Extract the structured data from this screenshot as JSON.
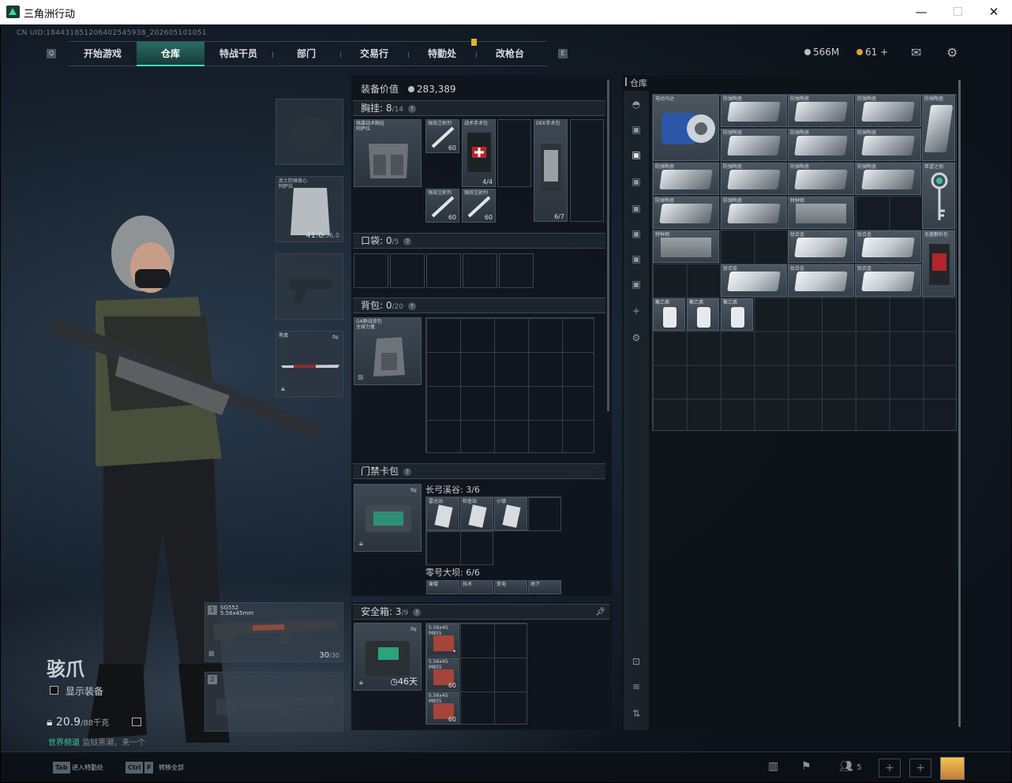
{
  "window": {
    "title": "三角洲行动",
    "controls": [
      "—",
      "☐",
      "✕"
    ]
  },
  "uid": "CN UID:18443185120640254593​8_202605101051",
  "nav": {
    "tabs": [
      "开始游戏",
      "仓库",
      "特战干员",
      "部门",
      "交易行",
      "特勤处",
      "改枪台"
    ],
    "active": "仓库"
  },
  "currency": {
    "silver": "566M",
    "gold": "61",
    "gold_add": "+"
  },
  "character": {
    "name": "骇爪",
    "show_equipment": "显示装备",
    "weight": "20.9",
    "weight_max": "/88千克",
    "ticker_prefix": "世界频道",
    "ticker_text": "监狱黑潮，来一个"
  },
  "left_slots": {
    "armor": {
      "label": "武士防弹背心\n阿萨拉",
      "value": "41.0",
      "max": "/56.0"
    },
    "melee": {
      "label": "黑鹰"
    },
    "gun1": {
      "num": "1",
      "name": "SG552",
      "caliber": "5.56x45mm",
      "ammo": "30",
      "ammo_max": "/30"
    },
    "gun2": {
      "num": "2"
    }
  },
  "equipment": {
    "value_label": "装备价值",
    "value": "283,389",
    "chest": {
      "title": "胸挂",
      "count": "8",
      "cap": "/14",
      "rig_label": "强袭战术胸挂\n阿萨拉",
      "items": [
        {
          "label": "强效注射剂",
          "n": "60"
        },
        {
          "label": "战术手术包",
          "n": "4/4"
        },
        {
          "label": "强效注射剂",
          "n": "60"
        },
        {
          "label": "强效注射剂",
          "n": "60"
        },
        {
          "label": "DEK手术包",
          "n": "6/7"
        }
      ]
    },
    "pocket": {
      "title": "口袋",
      "count": "0",
      "cap": "/5"
    },
    "backpack": {
      "title": "背包",
      "count": "0",
      "cap": "/20",
      "bag_label": "GA野战背包\n全球力量"
    },
    "keycard": {
      "title": "门禁卡包",
      "map1": "长弓溪谷: 3/6",
      "map1_items": [
        "雷达站",
        "检查站",
        "小镇"
      ],
      "map2": "零号大坝: 6/6",
      "map2_items": [
        "東楼",
        "技术",
        "变电",
        "地下"
      ]
    },
    "safebox": {
      "title": "安全箱",
      "count": "3",
      "cap": "/9",
      "timer": "46天",
      "ammo": [
        {
          "label": "5.56x45\nM855",
          "n": "•"
        },
        {
          "label": "5.56x45\nM855",
          "n": "60"
        },
        {
          "label": "5.56x45\nM855",
          "n": "60"
        }
      ]
    }
  },
  "stash": {
    "title": "仓库",
    "items": [
      {
        "label": "电动马达"
      },
      {
        "label": "防弹陶瓷"
      },
      {
        "label": "防弹陶瓷"
      },
      {
        "label": "防弹陶瓷"
      },
      {
        "label": "防弹陶瓷"
      },
      {
        "label": "防弹陶瓷"
      },
      {
        "label": "防弹陶瓷"
      },
      {
        "label": "防弹陶瓷"
      },
      {
        "label": "防弹陶瓷"
      },
      {
        "label": "防弹陶瓷"
      },
      {
        "label": "防弹陶瓷"
      },
      {
        "label": "防弹陶瓷"
      },
      {
        "label": "希望之钥"
      },
      {
        "label": "防弹陶瓷"
      },
      {
        "label": "防弹陶瓷"
      },
      {
        "label": "特种钢"
      },
      {
        "label": "特种钢"
      },
      {
        "label": "钛合金"
      },
      {
        "label": "钛合金"
      },
      {
        "label": "无菌敷料包"
      },
      {
        "label": "钛合金"
      },
      {
        "label": "钛合金"
      },
      {
        "label": "钛合金"
      },
      {
        "label": "聚乙烯"
      },
      {
        "label": "聚乙烯"
      },
      {
        "label": "聚乙烯"
      }
    ]
  },
  "bottom": {
    "tab_key": "Tab",
    "tab_label": "进入特勤处",
    "ctrl_key": "Ctrl",
    "f_key": "F",
    "transfer_label": "转移全部",
    "friends": "5"
  }
}
